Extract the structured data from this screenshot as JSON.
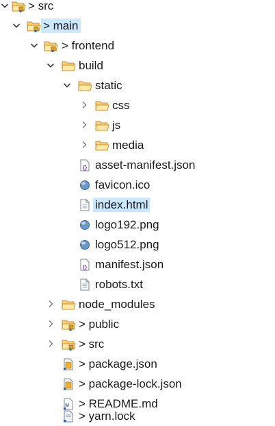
{
  "colors": {
    "selection": "#cce8ff",
    "folder_fill": "#fbd27a",
    "folder_stroke": "#c9902b",
    "marker": "#2a63c8"
  },
  "tree": [
    {
      "label": "> src",
      "icon": "package-folder-icon",
      "expanded": true
    },
    {
      "label": "> main",
      "icon": "package-folder-icon",
      "expanded": true,
      "selected": true
    },
    {
      "label": "> frontend",
      "icon": "package-folder-icon",
      "expanded": true
    },
    {
      "label": "build",
      "icon": "folder-icon",
      "expanded": true
    },
    {
      "label": "static",
      "icon": "folder-icon",
      "expanded": true
    },
    {
      "label": "css",
      "icon": "folder-icon",
      "expanded": false
    },
    {
      "label": "js",
      "icon": "folder-icon",
      "expanded": false
    },
    {
      "label": "media",
      "icon": "folder-icon",
      "expanded": false
    },
    {
      "label": "asset-manifest.json",
      "icon": "json-file-icon"
    },
    {
      "label": "favicon.ico",
      "icon": "globe-file-icon"
    },
    {
      "label": "index.html",
      "icon": "text-file-icon",
      "selected": true
    },
    {
      "label": "logo192.png",
      "icon": "globe-file-icon"
    },
    {
      "label": "logo512.png",
      "icon": "globe-file-icon"
    },
    {
      "label": "manifest.json",
      "icon": "json-file-icon"
    },
    {
      "label": "robots.txt",
      "icon": "text-file-icon"
    },
    {
      "label": "node_modules",
      "icon": "folder-icon",
      "expanded": false
    },
    {
      "label": "> public",
      "icon": "package-folder-icon",
      "expanded": false
    },
    {
      "label": "> src",
      "icon": "package-folder-icon",
      "expanded": false
    },
    {
      "label": "> package.json",
      "icon": "json-file-modified-icon"
    },
    {
      "label": "> package-lock.json",
      "icon": "json-file-modified-icon"
    },
    {
      "label": "> README.md",
      "icon": "markdown-file-icon"
    },
    {
      "label": "> yarn.lock",
      "icon": "text-file-modified-icon"
    }
  ]
}
